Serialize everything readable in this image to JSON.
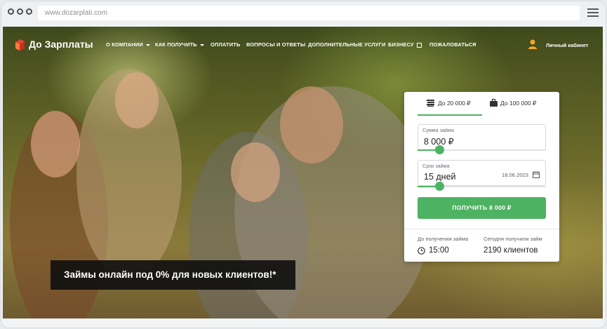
{
  "browser": {
    "url": "www.dozarplati.com"
  },
  "brand": {
    "name": "До Зарплаты",
    "accent": "#4db262",
    "logo_color": "#e8452e"
  },
  "nav": {
    "items": [
      {
        "label": "О КОМПАНИИ",
        "has_dropdown": true
      },
      {
        "label": "КАК ПОЛУЧИТЬ",
        "has_dropdown": true
      },
      {
        "label": "ОПЛАТИТЬ"
      },
      {
        "label": "ВОПРОСЫ И ОТВЕТЫ"
      },
      {
        "label": "ДОПОЛНИТЕЛЬНЫЕ УСЛУГИ"
      },
      {
        "label": "БИЗНЕСУ",
        "external": true
      },
      {
        "label": "ПОЖАЛОВАТЬСЯ"
      }
    ],
    "account_label": "Личный кабинет"
  },
  "loan_form": {
    "tabs": [
      {
        "label": "До 20 000 ₽",
        "icon": "money-stack-icon",
        "active": true
      },
      {
        "label": "До 100 000 ₽",
        "icon": "briefcase-icon",
        "active": false
      }
    ],
    "amount": {
      "label": "Сумма займа",
      "value": "8 000 ₽",
      "slider_fraction": 0.17
    },
    "term": {
      "label": "Срок займа",
      "value": "15 дней",
      "date": "18.06.2023",
      "slider_fraction": 0.17
    },
    "submit_label": "ПОЛУЧИТЬ 8 000 ₽",
    "info": {
      "time_label": "До получения займа",
      "time_value": "15:00",
      "count_label": "Сегодня получили займ",
      "count_value": "2190 клиентов"
    }
  },
  "hero": {
    "promo_text": "Займы онлайн под 0% для новых клиентов!*"
  }
}
